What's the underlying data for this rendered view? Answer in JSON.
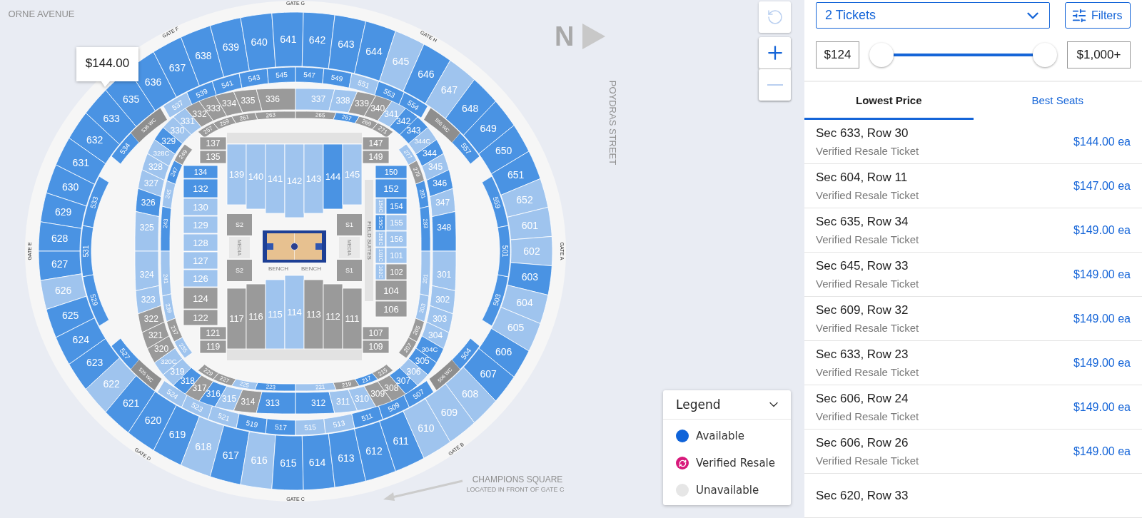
{
  "map": {
    "streets": [
      {
        "label": "ORNE AVENUE"
      },
      {
        "label": "POYDRAS STREET"
      }
    ],
    "compass": "N",
    "gates": [
      "GATE G",
      "GATE F",
      "GATE H",
      "GATE E",
      "GATE A",
      "GATE D",
      "GATE B",
      "GATE C"
    ],
    "upper_ring": {
      "top": [
        {
          "label": "635",
          "available": true,
          "in_range": true
        },
        {
          "label": "636",
          "available": true,
          "in_range": true
        },
        {
          "label": "637",
          "available": true,
          "in_range": true
        },
        {
          "label": "638",
          "available": true,
          "in_range": true
        },
        {
          "label": "639",
          "available": true,
          "in_range": true
        },
        {
          "label": "640",
          "available": true,
          "in_range": true
        },
        {
          "label": "641",
          "available": true,
          "in_range": true
        },
        {
          "label": "642",
          "available": true,
          "in_range": true
        },
        {
          "label": "643",
          "available": true,
          "in_range": true
        },
        {
          "label": "644",
          "available": true,
          "in_range": true
        },
        {
          "label": "645",
          "available": true,
          "in_range": false
        },
        {
          "label": "646",
          "available": true,
          "in_range": true
        },
        {
          "label": "647",
          "available": true,
          "in_range": false
        }
      ],
      "left_side": [
        {
          "label": "633",
          "available": true,
          "in_range": true
        },
        {
          "label": "632",
          "available": true,
          "in_range": true
        },
        {
          "label": "631",
          "available": true,
          "in_range": true
        },
        {
          "label": "630",
          "available": true,
          "in_range": true
        },
        {
          "label": "629",
          "available": true,
          "in_range": true
        },
        {
          "label": "628",
          "available": true,
          "in_range": true
        },
        {
          "label": "627",
          "available": true,
          "in_range": true
        },
        {
          "label": "626",
          "available": true,
          "in_range": false
        },
        {
          "label": "625",
          "available": true,
          "in_range": true
        },
        {
          "label": "624",
          "available": true,
          "in_range": true
        },
        {
          "label": "623",
          "available": true,
          "in_range": true
        },
        {
          "label": "622",
          "available": true,
          "in_range": false
        }
      ],
      "right_side": [
        {
          "label": "648",
          "available": true,
          "in_range": true
        },
        {
          "label": "649",
          "available": true,
          "in_range": true
        },
        {
          "label": "650",
          "available": true,
          "in_range": true
        },
        {
          "label": "651",
          "available": true,
          "in_range": true
        },
        {
          "label": "652",
          "available": true,
          "in_range": false
        },
        {
          "label": "601",
          "available": true,
          "in_range": false
        },
        {
          "label": "602",
          "available": true,
          "in_range": false
        },
        {
          "label": "603",
          "available": true,
          "in_range": true
        },
        {
          "label": "604",
          "available": true,
          "in_range": false
        },
        {
          "label": "605",
          "available": true,
          "in_range": false
        },
        {
          "label": "606",
          "available": true,
          "in_range": true
        },
        {
          "label": "607",
          "available": true,
          "in_range": true
        },
        {
          "label": "608",
          "available": true,
          "in_range": false
        }
      ],
      "bottom": [
        {
          "label": "621",
          "available": true,
          "in_range": true
        },
        {
          "label": "620",
          "available": true,
          "in_range": true
        },
        {
          "label": "619",
          "available": true,
          "in_range": true
        },
        {
          "label": "618",
          "available": true,
          "in_range": false
        },
        {
          "label": "617",
          "available": true,
          "in_range": true
        },
        {
          "label": "616",
          "available": true,
          "in_range": false
        },
        {
          "label": "615",
          "available": true,
          "in_range": true
        },
        {
          "label": "614",
          "available": true,
          "in_range": true
        },
        {
          "label": "613",
          "available": true,
          "in_range": true
        },
        {
          "label": "612",
          "available": true,
          "in_range": true
        },
        {
          "label": "611",
          "available": true,
          "in_range": true
        },
        {
          "label": "610",
          "available": true,
          "in_range": false
        },
        {
          "label": "609",
          "available": true,
          "in_range": false
        }
      ]
    },
    "club_ring": {
      "upper_half": [
        {
          "label": "533",
          "available": true,
          "in_range": true
        },
        {
          "label": "534",
          "available": true,
          "in_range": true
        },
        {
          "label": "537",
          "available": true,
          "in_range": false
        },
        {
          "label": "539",
          "available": true,
          "in_range": true
        },
        {
          "label": "541",
          "available": true,
          "in_range": true
        },
        {
          "label": "543",
          "available": true,
          "in_range": true
        },
        {
          "label": "545",
          "available": true,
          "in_range": true
        },
        {
          "label": "547",
          "available": true,
          "in_range": true
        },
        {
          "label": "549",
          "available": true,
          "in_range": true
        },
        {
          "label": "551",
          "available": true,
          "in_range": false
        },
        {
          "label": "553",
          "available": true,
          "in_range": true
        },
        {
          "label": "554",
          "available": true,
          "in_range": true
        },
        {
          "label": "557",
          "available": true,
          "in_range": true
        },
        {
          "label": "559",
          "available": true,
          "in_range": true
        }
      ],
      "lower_half": [
        {
          "label": "531",
          "available": true,
          "in_range": true
        },
        {
          "label": "529",
          "available": true,
          "in_range": true
        },
        {
          "label": "527",
          "available": true,
          "in_range": true
        },
        {
          "label": "524",
          "available": true,
          "in_range": false
        },
        {
          "label": "523",
          "available": true,
          "in_range": false
        },
        {
          "label": "521",
          "available": true,
          "in_range": false
        },
        {
          "label": "519",
          "available": true,
          "in_range": true
        },
        {
          "label": "517",
          "available": true,
          "in_range": true
        },
        {
          "label": "515",
          "available": true,
          "in_range": false
        },
        {
          "label": "513",
          "available": true,
          "in_range": false
        },
        {
          "label": "511",
          "available": true,
          "in_range": true
        },
        {
          "label": "509",
          "available": true,
          "in_range": true
        },
        {
          "label": "507",
          "available": true,
          "in_range": true
        },
        {
          "label": "504",
          "available": true,
          "in_range": true
        },
        {
          "label": "503",
          "available": true,
          "in_range": true
        },
        {
          "label": "501",
          "available": true,
          "in_range": true
        }
      ]
    },
    "wc_passages": [
      "536 WC",
      "555 WC",
      "525 WC",
      "506 WC"
    ],
    "plaza_ring": {
      "top": [
        {
          "label": "331",
          "available": true,
          "in_range": false
        },
        {
          "label": "332",
          "available": false,
          "in_range": false
        },
        {
          "label": "333",
          "available": false,
          "in_range": false
        },
        {
          "label": "334",
          "available": false,
          "in_range": false
        },
        {
          "label": "335",
          "available": false,
          "in_range": false
        },
        {
          "label": "336",
          "available": false,
          "in_range": false
        },
        {
          "label": "337",
          "available": true,
          "in_range": false
        },
        {
          "label": "338",
          "available": true,
          "in_range": false
        },
        {
          "label": "339",
          "available": false,
          "in_range": false
        },
        {
          "label": "340",
          "available": false,
          "in_range": false
        },
        {
          "label": "341",
          "available": true,
          "in_range": false
        },
        {
          "label": "342",
          "available": true,
          "in_range": true
        }
      ],
      "left_side": [
        {
          "label": "330",
          "available": true,
          "in_range": false
        },
        {
          "label": "329",
          "available": true,
          "in_range": true
        },
        {
          "label": "328C",
          "available": true,
          "in_range": false
        },
        {
          "label": "328",
          "available": true,
          "in_range": false
        },
        {
          "label": "327",
          "available": true,
          "in_range": false
        },
        {
          "label": "326",
          "available": true,
          "in_range": true
        },
        {
          "label": "325",
          "available": true,
          "in_range": false
        },
        {
          "label": "324",
          "available": true,
          "in_range": false
        },
        {
          "label": "323",
          "available": true,
          "in_range": false
        },
        {
          "label": "322",
          "available": false,
          "in_range": false
        },
        {
          "label": "321",
          "available": false,
          "in_range": false
        },
        {
          "label": "320",
          "available": false,
          "in_range": false
        },
        {
          "label": "320C",
          "available": true,
          "in_range": false
        }
      ],
      "right_side": [
        {
          "label": "343",
          "available": true,
          "in_range": true
        },
        {
          "label": "344C",
          "available": true,
          "in_range": false
        },
        {
          "label": "344",
          "available": true,
          "in_range": true
        },
        {
          "label": "345",
          "available": true,
          "in_range": false
        },
        {
          "label": "346",
          "available": true,
          "in_range": true
        },
        {
          "label": "347",
          "available": true,
          "in_range": false
        },
        {
          "label": "348",
          "available": true,
          "in_range": true
        },
        {
          "label": "301",
          "available": true,
          "in_range": false
        },
        {
          "label": "302",
          "available": true,
          "in_range": false
        },
        {
          "label": "303",
          "available": true,
          "in_range": false
        },
        {
          "label": "304",
          "available": true,
          "in_range": false
        },
        {
          "label": "304C",
          "available": true,
          "in_range": true
        },
        {
          "label": "305",
          "available": true,
          "in_range": true
        }
      ],
      "bottom": [
        {
          "label": "319",
          "available": true,
          "in_range": false
        },
        {
          "label": "318",
          "available": true,
          "in_range": true
        },
        {
          "label": "317",
          "available": false,
          "in_range": false
        },
        {
          "label": "316",
          "available": true,
          "in_range": true
        },
        {
          "label": "315",
          "available": true,
          "in_range": false
        },
        {
          "label": "314",
          "available": false,
          "in_range": false
        },
        {
          "label": "313",
          "available": true,
          "in_range": true
        },
        {
          "label": "312",
          "available": true,
          "in_range": true
        },
        {
          "label": "311",
          "available": true,
          "in_range": false
        },
        {
          "label": "310",
          "available": true,
          "in_range": false
        },
        {
          "label": "309",
          "available": false,
          "in_range": false
        },
        {
          "label": "308",
          "available": false,
          "in_range": false
        },
        {
          "label": "307",
          "available": true,
          "in_range": true
        },
        {
          "label": "306",
          "available": true,
          "in_range": false
        }
      ]
    },
    "suite_ring": {
      "upper_half": [
        {
          "label": "243",
          "available": true,
          "in_range": true
        },
        {
          "label": "245",
          "available": true,
          "in_range": false
        },
        {
          "label": "247",
          "available": true,
          "in_range": true
        },
        {
          "label": "249",
          "available": false,
          "in_range": false
        },
        {
          "label": "257",
          "available": false,
          "in_range": false
        },
        {
          "label": "259",
          "available": false,
          "in_range": false
        },
        {
          "label": "261",
          "available": false,
          "in_range": false
        },
        {
          "label": "263",
          "available": false,
          "in_range": false
        },
        {
          "label": "265",
          "available": false,
          "in_range": false
        },
        {
          "label": "267",
          "available": true,
          "in_range": true
        },
        {
          "label": "269",
          "available": false,
          "in_range": false
        },
        {
          "label": "271",
          "available": false,
          "in_range": false
        },
        {
          "label": "277",
          "available": true,
          "in_range": false
        },
        {
          "label": "279",
          "available": false,
          "in_range": false
        },
        {
          "label": "281",
          "available": true,
          "in_range": true
        },
        {
          "label": "283",
          "available": true,
          "in_range": true
        }
      ],
      "lower_half": [
        {
          "label": "241",
          "available": true,
          "in_range": false
        },
        {
          "label": "239",
          "available": true,
          "in_range": false
        },
        {
          "label": "237",
          "available": false,
          "in_range": false
        },
        {
          "label": "235",
          "available": true,
          "in_range": false
        },
        {
          "label": "229",
          "available": false,
          "in_range": false
        },
        {
          "label": "227",
          "available": false,
          "in_range": false
        },
        {
          "label": "225",
          "available": true,
          "in_range": false
        },
        {
          "label": "223",
          "available": true,
          "in_range": true
        },
        {
          "label": "221",
          "available": true,
          "in_range": false
        },
        {
          "label": "219",
          "available": false,
          "in_range": false
        },
        {
          "label": "217",
          "available": true,
          "in_range": true
        },
        {
          "label": "215",
          "available": false,
          "in_range": false
        },
        {
          "label": "207",
          "available": false,
          "in_range": false
        },
        {
          "label": "205",
          "available": false,
          "in_range": false
        },
        {
          "label": "203",
          "available": true,
          "in_range": false
        },
        {
          "label": "201",
          "available": true,
          "in_range": false
        }
      ]
    },
    "floor": {
      "top_row": [
        {
          "label": "139",
          "available": true,
          "in_range": false
        },
        {
          "label": "140",
          "available": true,
          "in_range": false
        },
        {
          "label": "141",
          "available": true,
          "in_range": false
        },
        {
          "label": "142",
          "available": true,
          "in_range": false
        },
        {
          "label": "143",
          "available": true,
          "in_range": false
        },
        {
          "label": "144",
          "available": true,
          "in_range": true
        },
        {
          "label": "145",
          "available": true,
          "in_range": false
        }
      ],
      "bottom_row": [
        {
          "label": "117",
          "available": false,
          "in_range": false
        },
        {
          "label": "116",
          "available": false,
          "in_range": false
        },
        {
          "label": "115",
          "available": true,
          "in_range": false
        },
        {
          "label": "114",
          "available": true,
          "in_range": false
        },
        {
          "label": "113",
          "available": false,
          "in_range": false
        },
        {
          "label": "112",
          "available": false,
          "in_range": false
        },
        {
          "label": "111",
          "available": false,
          "in_range": false
        }
      ],
      "left_column": [
        {
          "label": "134",
          "available": true,
          "in_range": true
        },
        {
          "label": "132",
          "available": true,
          "in_range": true
        },
        {
          "label": "130",
          "available": true,
          "in_range": false
        },
        {
          "label": "129",
          "available": true,
          "in_range": false
        },
        {
          "label": "128",
          "available": true,
          "in_range": false
        },
        {
          "label": "127",
          "available": true,
          "in_range": false
        },
        {
          "label": "126",
          "available": true,
          "in_range": false
        },
        {
          "label": "124",
          "available": false,
          "in_range": false
        },
        {
          "label": "122",
          "available": false,
          "in_range": false
        }
      ],
      "right_column": [
        [
          {
            "label": "150",
            "available": true,
            "in_range": true
          }
        ],
        [
          {
            "label": "152",
            "available": true,
            "in_range": true
          }
        ],
        [
          {
            "label": "154C",
            "available": true,
            "in_range": false
          },
          {
            "label": "154",
            "available": true,
            "in_range": true
          }
        ],
        [
          {
            "label": "155C",
            "available": true,
            "in_range": true
          },
          {
            "label": "155",
            "available": true,
            "in_range": false
          }
        ],
        [
          {
            "label": "156C",
            "available": true,
            "in_range": false
          },
          {
            "label": "156",
            "available": true,
            "in_range": false
          }
        ],
        [
          {
            "label": "101C",
            "available": true,
            "in_range": false
          },
          {
            "label": "101",
            "available": true,
            "in_range": false
          }
        ],
        [
          {
            "label": "102C",
            "available": true,
            "in_range": false
          },
          {
            "label": "102",
            "available": false,
            "in_range": false
          }
        ],
        [
          {
            "label": "104",
            "available": false,
            "in_range": false
          }
        ],
        [
          {
            "label": "106",
            "available": false,
            "in_range": false
          }
        ]
      ],
      "corner_blocks": [
        [
          {
            "label": "137",
            "available": false,
            "in_range": false
          },
          {
            "label": "135",
            "available": false,
            "in_range": false
          }
        ],
        [
          {
            "label": "147",
            "available": false,
            "in_range": false
          },
          {
            "label": "149",
            "available": false,
            "in_range": false
          }
        ],
        [
          {
            "label": "121",
            "available": false,
            "in_range": false
          },
          {
            "label": "119",
            "available": false,
            "in_range": false
          }
        ],
        [
          {
            "label": "107",
            "available": false,
            "in_range": false
          },
          {
            "label": "109",
            "available": false,
            "in_range": false
          }
        ]
      ],
      "stage_blocks": [
        {
          "labels": [
            "S2",
            "S2"
          ],
          "media": "MEDIA"
        },
        {
          "labels": [
            "S1",
            "S1"
          ],
          "media": "MEDIA"
        }
      ],
      "benches": [
        "BENCH",
        "BENCH"
      ],
      "field_suites": "FIELD SUITES"
    },
    "callout": {
      "label": "CHAMPIONS SQUARE",
      "note": "LOCATED IN FRONT OF GATE C"
    },
    "tooltip": {
      "price": "$144.00"
    }
  },
  "map_controls": [
    {
      "kind": "reset",
      "disabled": true
    },
    {
      "kind": "zoom_in",
      "disabled": false
    },
    {
      "kind": "zoom_out",
      "disabled": true
    }
  ],
  "legend": {
    "title": "Legend",
    "expanded": true,
    "items": [
      {
        "label": "Available",
        "kind": "available"
      },
      {
        "label": "Verified Resale",
        "kind": "resale"
      },
      {
        "label": "Unavailable",
        "kind": "unavailable"
      }
    ]
  },
  "panel": {
    "quantity": {
      "value": "2 Tickets"
    },
    "filters_button": "Filters",
    "price_range": {
      "min": "$124",
      "max": "$1,000+",
      "handles": [
        {
          "level": 0
        },
        {
          "level": 1
        }
      ]
    },
    "tabs": [
      {
        "label": "Lowest Price",
        "selected": true
      },
      {
        "label": "Best Seats",
        "selected": false
      }
    ],
    "listings": [
      {
        "title": "Sec 633, Row 30",
        "subtitle": "Verified Resale Ticket",
        "price": "$144.00 ea"
      },
      {
        "title": "Sec 604, Row 11",
        "subtitle": "Verified Resale Ticket",
        "price": "$147.00 ea"
      },
      {
        "title": "Sec 635, Row 34",
        "subtitle": "Verified Resale Ticket",
        "price": "$149.00 ea"
      },
      {
        "title": "Sec 645, Row 33",
        "subtitle": "Verified Resale Ticket",
        "price": "$149.00 ea"
      },
      {
        "title": "Sec 609, Row 32",
        "subtitle": "Verified Resale Ticket",
        "price": "$149.00 ea"
      },
      {
        "title": "Sec 633, Row 23",
        "subtitle": "Verified Resale Ticket",
        "price": "$149.00 ea"
      },
      {
        "title": "Sec 606, Row 24",
        "subtitle": "Verified Resale Ticket",
        "price": "$149.00 ea"
      },
      {
        "title": "Sec 606, Row 26",
        "subtitle": "Verified Resale Ticket",
        "price": "$149.00 ea"
      },
      {
        "title": "Sec 620, Row 33"
      }
    ]
  }
}
